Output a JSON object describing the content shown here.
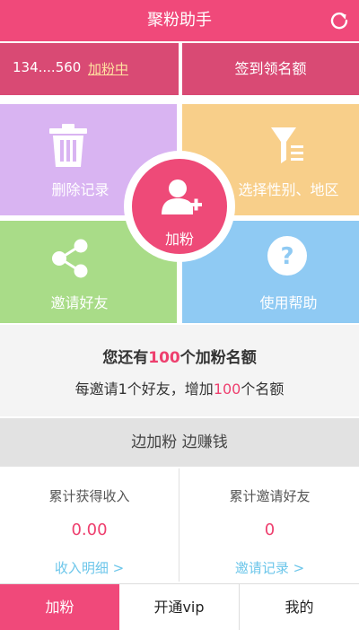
{
  "header": {
    "title": "聚粉助手",
    "refresh_icon": "refresh-icon"
  },
  "account": {
    "number": "134....560",
    "status": "加粉中"
  },
  "signin": {
    "label": "签到领名额"
  },
  "tiles": {
    "delete": {
      "label": "删除记录",
      "icon": "trash-icon"
    },
    "filter": {
      "label": "选择性别、地区",
      "icon": "filter-icon"
    },
    "invite": {
      "label": "邀请好友",
      "icon": "share-icon"
    },
    "help": {
      "label": "使用帮助",
      "icon": "help-icon"
    }
  },
  "center": {
    "label": "加粉",
    "icon": "add-user-icon"
  },
  "quota": {
    "prefix": "您还有",
    "count": "100",
    "suffix": "个加粉名额",
    "rule_prefix": "每邀请1个好友，增加",
    "rule_count": "100",
    "rule_suffix": "个名额"
  },
  "slogan": "边加粉 边赚钱",
  "stats": {
    "income": {
      "caption": "累计获得收入",
      "value": "0.00",
      "link": "收入明细 >"
    },
    "invites": {
      "caption": "累计邀请好友",
      "value": "0",
      "link": "邀请记录 >"
    }
  },
  "tabs": [
    {
      "label": "加粉"
    },
    {
      "label": "开通vip"
    },
    {
      "label": "我的"
    }
  ],
  "colors": {
    "brand": "#f0497a",
    "accent_red": "#ee3f6e",
    "link_blue": "#6cc6ea",
    "tile_purple": "#d9b4f2",
    "tile_orange": "#f8cf8a",
    "tile_green": "#a9dc88",
    "tile_blue": "#8fcaf3"
  }
}
